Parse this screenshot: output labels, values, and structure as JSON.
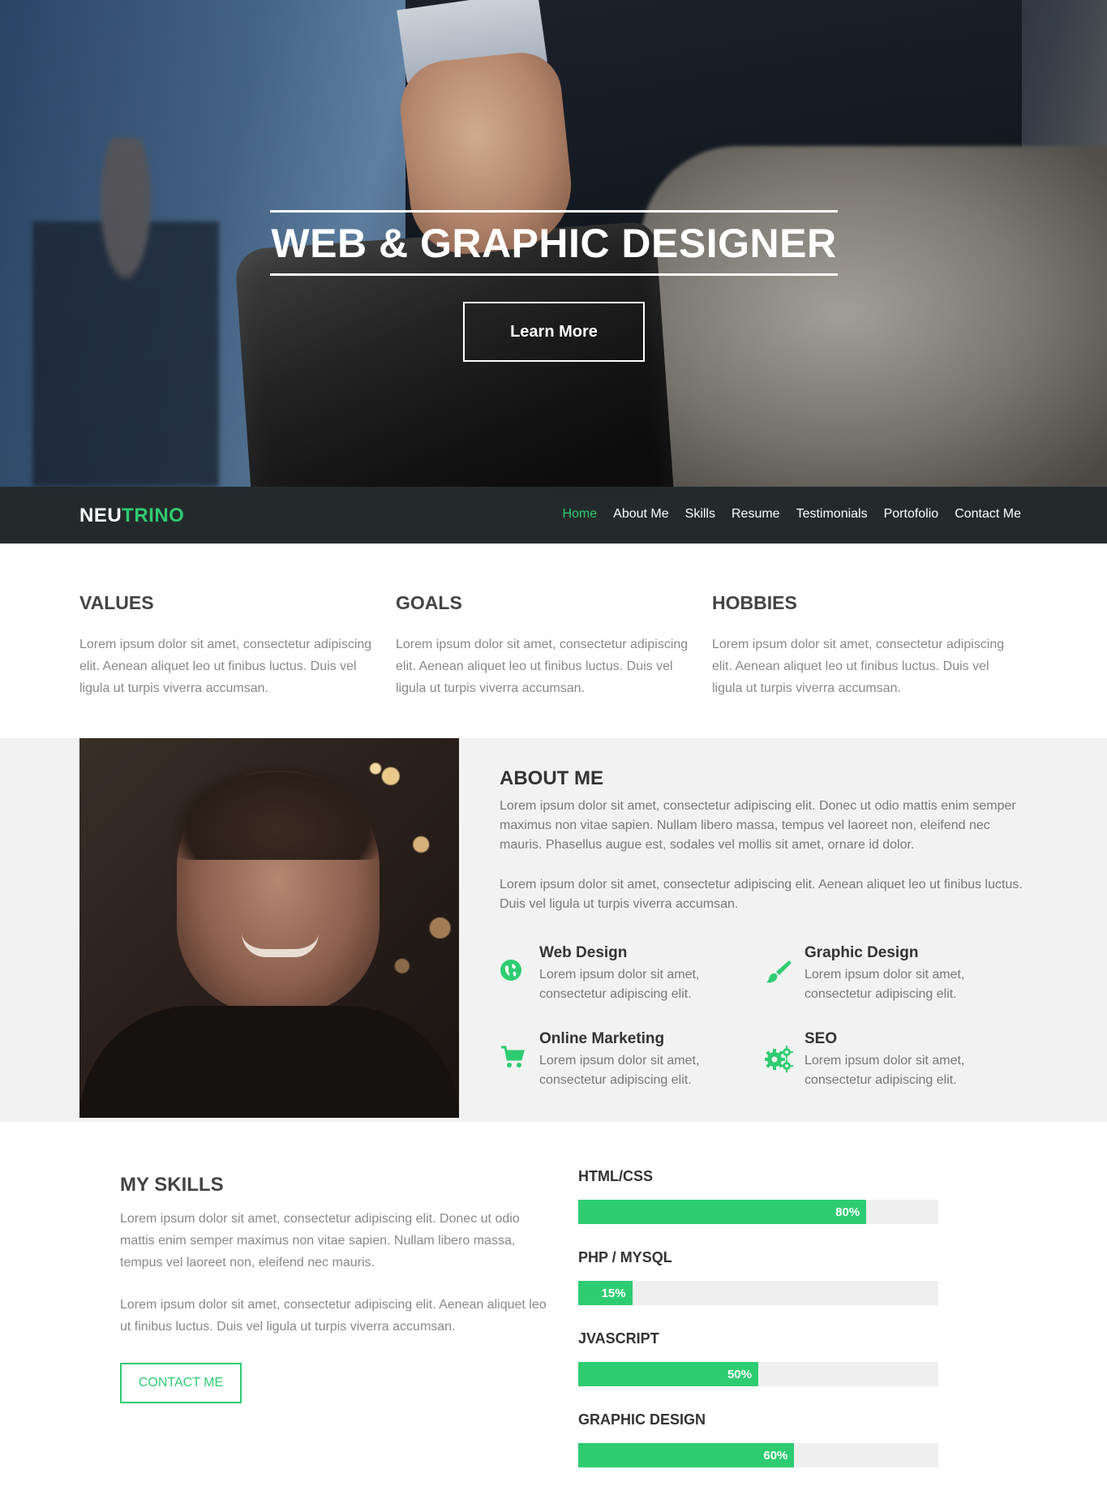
{
  "hero": {
    "title": "WEB & GRAPHIC DESIGNER",
    "button": "Learn More"
  },
  "nav": {
    "logo_part1": "NEU",
    "logo_part2": "TRINO",
    "items": [
      {
        "label": "Home",
        "active": true
      },
      {
        "label": "About Me"
      },
      {
        "label": "Skills"
      },
      {
        "label": "Resume"
      },
      {
        "label": "Testimonials"
      },
      {
        "label": "Portofolio"
      },
      {
        "label": "Contact Me"
      }
    ]
  },
  "features": [
    {
      "title": "VALUES",
      "text": "Lorem ipsum dolor sit amet, consectetur adipiscing elit. Aenean aliquet leo ut finibus luctus. Duis vel ligula ut turpis viverra accumsan."
    },
    {
      "title": "GOALS",
      "text": "Lorem ipsum dolor sit amet, consectetur adipiscing elit. Aenean aliquet leo ut finibus luctus. Duis vel ligula ut turpis viverra accumsan."
    },
    {
      "title": "HOBBIES",
      "text": "Lorem ipsum dolor sit amet, consectetur adipiscing elit. Aenean aliquet leo ut finibus luctus. Duis vel ligula ut turpis viverra accumsan."
    }
  ],
  "about": {
    "title": "ABOUT ME",
    "p1": "Lorem ipsum dolor sit amet, consectetur adipiscing elit. Donec ut odio mattis enim semper maximus non vitae sapien. Nullam libero massa, tempus vel laoreet non, eleifend nec mauris. Phasellus augue est, sodales vel mollis sit amet, ornare id dolor.",
    "p2": "Lorem ipsum dolor sit amet, consectetur adipiscing elit. Aenean aliquet leo ut finibus luctus. Duis vel ligula ut turpis viverra accumsan.",
    "services": [
      {
        "icon": "globe-icon",
        "title": "Web Design",
        "text": "Lorem ipsum dolor sit amet, consectetur adipiscing elit."
      },
      {
        "icon": "paintbrush-icon",
        "title": "Graphic Design",
        "text": "Lorem ipsum dolor sit amet, consectetur adipiscing elit."
      },
      {
        "icon": "shopping-cart-icon",
        "title": "Online Marketing",
        "text": "Lorem ipsum dolor sit amet, consectetur adipiscing elit."
      },
      {
        "icon": "gears-icon",
        "title": "SEO",
        "text": "Lorem ipsum dolor sit amet, consectetur adipiscing elit."
      }
    ]
  },
  "skills": {
    "title": "MY SKILLS",
    "p1": "Lorem ipsum dolor sit amet, consectetur adipiscing elit. Donec ut odio mattis enim semper maximus non vitae sapien. Nullam libero massa, tempus vel laoreet non, eleifend nec mauris.",
    "p2": "Lorem ipsum dolor sit amet, consectetur adipiscing elit. Aenean aliquet leo ut finibus luctus. Duis vel ligula ut turpis viverra accumsan.",
    "button": "CONTACT ME",
    "bars": [
      {
        "name": "HTML/CSS",
        "percent": 80,
        "label": "80%"
      },
      {
        "name": "PHP / MYSQL",
        "percent": 15,
        "label": "15%"
      },
      {
        "name": "JVASCRIPT",
        "percent": 50,
        "label": "50%"
      },
      {
        "name": "GRAPHIC DESIGN",
        "percent": 60,
        "label": "60%"
      }
    ]
  },
  "colors": {
    "accent": "#2ecc71",
    "nav_bg": "#242a2c",
    "about_bg": "#f2f2f2"
  }
}
